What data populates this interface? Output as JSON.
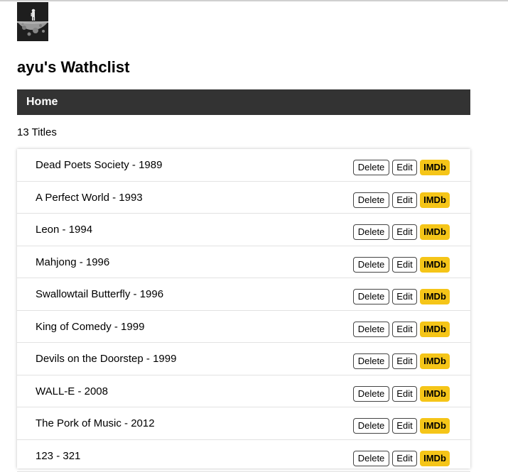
{
  "header": {
    "title": "ayu's Wathclist",
    "avatar_icon": "moon-astronaut-icon"
  },
  "nav": {
    "home_label": "Home",
    "background": "#333333"
  },
  "summary": {
    "count_label": "13 Titles"
  },
  "colors": {
    "imdb": "#f5c518"
  },
  "items": [
    {
      "label": "Dead Poets Society - 1989",
      "delete": "Delete",
      "edit": "Edit",
      "imdb": "IMDb"
    },
    {
      "label": "A Perfect World - 1993",
      "delete": "Delete",
      "edit": "Edit",
      "imdb": "IMDb"
    },
    {
      "label": "Leon - 1994",
      "delete": "Delete",
      "edit": "Edit",
      "imdb": "IMDb"
    },
    {
      "label": "Mahjong - 1996",
      "delete": "Delete",
      "edit": "Edit",
      "imdb": "IMDb"
    },
    {
      "label": "Swallowtail Butterfly - 1996",
      "delete": "Delete",
      "edit": "Edit",
      "imdb": "IMDb"
    },
    {
      "label": "King of Comedy - 1999",
      "delete": "Delete",
      "edit": "Edit",
      "imdb": "IMDb"
    },
    {
      "label": "Devils on the Doorstep - 1999",
      "delete": "Delete",
      "edit": "Edit",
      "imdb": "IMDb"
    },
    {
      "label": "WALL-E - 2008",
      "delete": "Delete",
      "edit": "Edit",
      "imdb": "IMDb"
    },
    {
      "label": "The Pork of Music - 2012",
      "delete": "Delete",
      "edit": "Edit",
      "imdb": "IMDb"
    },
    {
      "label": "123 - 321",
      "delete": "Delete",
      "edit": "Edit",
      "imdb": "IMDb"
    }
  ]
}
